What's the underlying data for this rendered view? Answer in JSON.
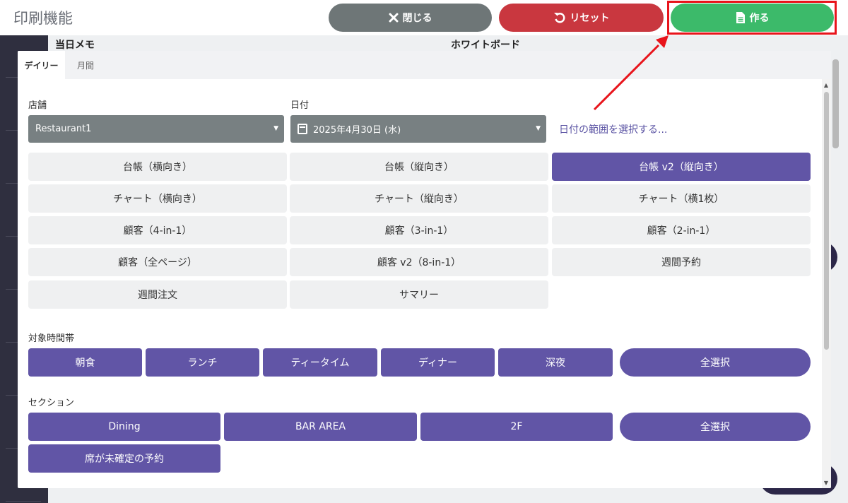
{
  "header": {
    "title": "印刷機能",
    "close_label": "閉じる",
    "reset_label": "リセット",
    "create_label": "作る"
  },
  "background": {
    "memo_label": "当日メモ",
    "whiteboard_label": "ホワイトボード"
  },
  "tabs": [
    {
      "label": "デイリー",
      "active": true
    },
    {
      "label": "月間",
      "active": false
    }
  ],
  "store": {
    "label": "店舗",
    "value": "Restaurant1"
  },
  "date": {
    "label": "日付",
    "value": "2025年4月30日 (水)",
    "range_link": "日付の範囲を選択する..."
  },
  "templates": [
    {
      "label": "台帳（横向き）",
      "active": false
    },
    {
      "label": "台帳（縦向き）",
      "active": false
    },
    {
      "label": "台帳 v2（縦向き）",
      "active": true
    },
    {
      "label": "チャート（横向き）",
      "active": false
    },
    {
      "label": "チャート（縦向き）",
      "active": false
    },
    {
      "label": "チャート（横1枚）",
      "active": false
    },
    {
      "label": "顧客（4-in-1）",
      "active": false
    },
    {
      "label": "顧客（3-in-1）",
      "active": false
    },
    {
      "label": "顧客（2-in-1）",
      "active": false
    },
    {
      "label": "顧客（全ページ）",
      "active": false
    },
    {
      "label": "顧客 v2（8-in-1）",
      "active": false
    },
    {
      "label": "週間予約",
      "active": false
    },
    {
      "label": "週間注文",
      "active": false
    },
    {
      "label": "サマリー",
      "active": false
    }
  ],
  "timeslots": {
    "label": "対象時間帯",
    "items": [
      "朝食",
      "ランチ",
      "ティータイム",
      "ディナー",
      "深夜"
    ],
    "select_all": "全選択"
  },
  "sections": {
    "label": "セクション",
    "items": [
      "Dining",
      "BAR AREA",
      "2F"
    ],
    "select_all": "全選択",
    "unassigned": "席が未確定の予約"
  },
  "colors": {
    "accent": "#6155a6",
    "close": "#6e7677",
    "reset": "#c9373f",
    "create": "#3cba6a",
    "annotation": "#e8141b"
  }
}
